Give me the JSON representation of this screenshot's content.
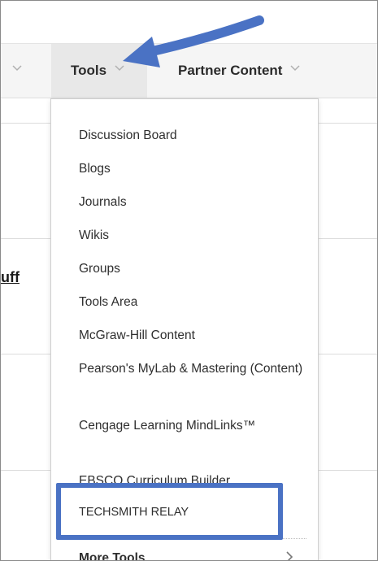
{
  "toolbar": {
    "tools_label": "Tools",
    "partner_label": "Partner Content"
  },
  "page": {
    "fragment_text": "uff"
  },
  "menu": {
    "items": [
      {
        "label": "Discussion Board"
      },
      {
        "label": "Blogs"
      },
      {
        "label": "Journals"
      },
      {
        "label": "Wikis"
      },
      {
        "label": "Groups"
      },
      {
        "label": "Tools Area"
      },
      {
        "label": "McGraw-Hill Content"
      },
      {
        "label": "Pearson's MyLab & Mastering (Content)"
      },
      {
        "label": "Cengage Learning MindLinks™"
      },
      {
        "label": "EBSCO Curriculum Builder"
      },
      {
        "label": "TECHSMITH RELAY"
      }
    ],
    "more_label": "More Tools"
  },
  "colors": {
    "highlight": "#4a72c4",
    "arrow": "#4a72c4",
    "toolbar_bg": "#f5f5f5"
  },
  "icons": [
    "chevron-down-icon",
    "chevron-right-icon",
    "annotation-arrow"
  ]
}
